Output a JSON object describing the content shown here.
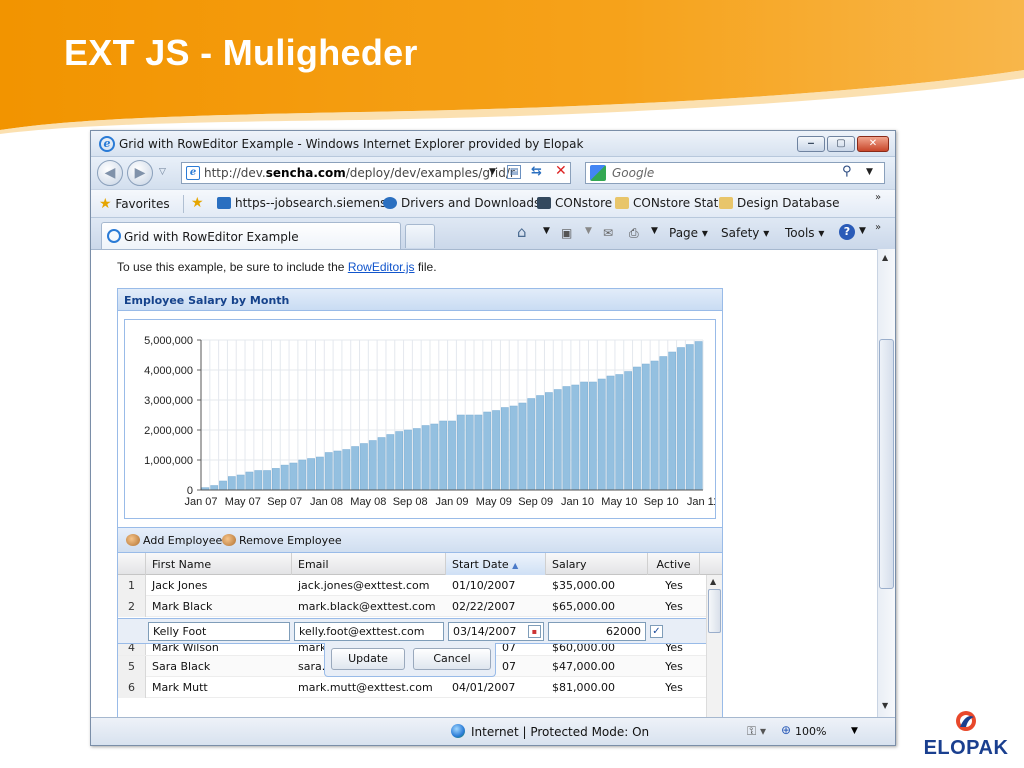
{
  "slide": {
    "title": "EXT JS - Muligheder",
    "logo_text": "ELOPAK"
  },
  "browser": {
    "window_title": "Grid with RowEditor Example - Windows Internet Explorer provided by Elopak",
    "address": "http://dev.sencha.com/deploy/dev/examples/grid/r",
    "address_host_bold": "sencha.com",
    "search_placeholder": "Google",
    "favorites_label": "Favorites",
    "favorites": [
      "https--jobsearch.siemens",
      "Drivers and Downloads",
      "CONstore",
      "CONstore Stat",
      "Design Database"
    ],
    "tab_label": "Grid with RowEditor Example",
    "commands": {
      "page": "Page",
      "safety": "Safety",
      "tools": "Tools"
    },
    "status": "Internet | Protected Mode: On",
    "zoom": "100%",
    "colors": {
      "frame": "#dfe8f5",
      "accent": "#15428b",
      "link": "#1155cc"
    },
    "icons": [
      "back-icon",
      "forward-icon",
      "ie-icon",
      "refresh-icon",
      "stop-icon",
      "search-icon",
      "star-icon",
      "home-icon",
      "feed-icon",
      "mail-icon",
      "print-icon",
      "help-icon",
      "globe-icon"
    ]
  },
  "page": {
    "intro_before": "To use this example, be sure to include the ",
    "intro_link": "RowEditor.js",
    "intro_after": " file.",
    "panel_title": "Employee Salary by Month",
    "toolbar": {
      "add": "Add Employee",
      "remove": "Remove Employee"
    },
    "columns": [
      "First Name",
      "Email",
      "Start Date",
      "Salary",
      "Active"
    ],
    "rows": [
      {
        "n": "1",
        "first": "Jack Jones",
        "email": "jack.jones@exttest.com",
        "start": "01/10/2007",
        "salary": "$35,000.00",
        "active": "Yes"
      },
      {
        "n": "2",
        "first": "Mark Black",
        "email": "mark.black@exttest.com",
        "start": "02/22/2007",
        "salary": "$65,000.00",
        "active": "Yes"
      },
      {
        "n": "4",
        "first": "Mark Wilson",
        "email": "mark",
        "start": "07",
        "salary": "$60,000.00",
        "active": "Yes"
      },
      {
        "n": "5",
        "first": "Sara Black",
        "email": "sara.",
        "start": "07",
        "salary": "$47,000.00",
        "active": "Yes"
      },
      {
        "n": "6",
        "first": "Mark Mutt",
        "email": "mark.mutt@exttest.com",
        "start": "04/01/2007",
        "salary": "$81,000.00",
        "active": "Yes"
      }
    ],
    "editor": {
      "first": "Kelly Foot",
      "email": "kelly.foot@exttest.com",
      "start": "03/14/2007",
      "salary": "62000",
      "active_checked": true,
      "update": "Update",
      "cancel": "Cancel"
    }
  },
  "chart_data": {
    "type": "bar",
    "title": "Employee Salary by Month",
    "xlabel": "",
    "ylabel": "",
    "ylim": [
      0,
      5000000
    ],
    "y_ticks": [
      "5,000,000",
      "4,000,000",
      "3,000,000",
      "2,000,000",
      "1,000,000",
      "0"
    ],
    "x_ticks": [
      "Jan 07",
      "May 07",
      "Sep 07",
      "Jan 08",
      "May 08",
      "Sep 08",
      "Jan 09",
      "May 09",
      "Sep 09",
      "Jan 10",
      "May 10",
      "Sep 10",
      "Jan 11"
    ],
    "grid": true,
    "values": [
      80000,
      150000,
      300000,
      450000,
      500000,
      600000,
      650000,
      650000,
      720000,
      830000,
      900000,
      1000000,
      1050000,
      1100000,
      1250000,
      1300000,
      1350000,
      1450000,
      1550000,
      1650000,
      1750000,
      1850000,
      1950000,
      2000000,
      2050000,
      2150000,
      2200000,
      2300000,
      2300000,
      2500000,
      2500000,
      2500000,
      2600000,
      2650000,
      2750000,
      2800000,
      2900000,
      3050000,
      3150000,
      3250000,
      3350000,
      3450000,
      3500000,
      3600000,
      3600000,
      3700000,
      3800000,
      3850000,
      3950000,
      4100000,
      4200000,
      4300000,
      4450000,
      4600000,
      4750000,
      4850000,
      4950000
    ],
    "bar_color": "#94c0e0"
  }
}
